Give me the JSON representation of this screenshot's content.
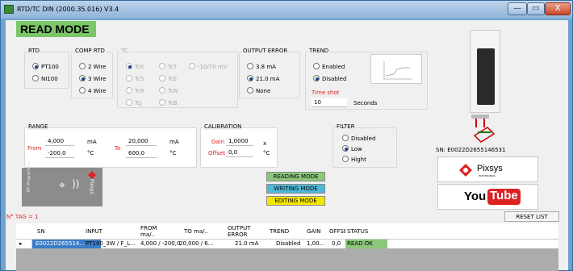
{
  "window": {
    "title": "RTD/TC DIN  (2000.35.016)  V3.4",
    "min": "—",
    "max": "▭",
    "close": "X"
  },
  "mode_title": "READ MODE",
  "rtd": {
    "label": "RTD",
    "opt1": "PT100",
    "opt2": "NI100"
  },
  "comp": {
    "label": "COMP RTD",
    "opt1": "2 Wire",
    "opt2": "3 Wire",
    "opt3": "4 Wire"
  },
  "tc": {
    "label": "TC",
    "k": "TcK",
    "s": "TcS",
    "r": "TcR",
    "j": "TcJ",
    "t": "TcT",
    "e": "TcE",
    "n": "TcN",
    "b": "TcB",
    "mv": "-10/70 mV"
  },
  "output_error": {
    "label": "OUTPUT ERROR",
    "opt1": "3.8 mA",
    "opt2": "21.0 mA",
    "opt3": "None"
  },
  "trend": {
    "label": "TREND",
    "opt1": "Enabled",
    "opt2": "Disabled",
    "time_shot_label": "Time shot",
    "time_shot": "10",
    "seconds": "Seconds"
  },
  "range": {
    "label": "RANGE",
    "from_label": "From",
    "to_label": "To",
    "from_ma": "4,000",
    "from_c": "-200,0",
    "to_ma": "20,000",
    "to_c": "600,0",
    "unit_ma": "mA",
    "unit_c": "°C"
  },
  "calibration": {
    "label": "CALIBRATION",
    "gain_label": "Gain",
    "gain": "1,0000",
    "gain_unit": "x",
    "offset_label": "Offset",
    "offset": "0,0",
    "offset_unit": "°C"
  },
  "filter": {
    "label": "FILTER",
    "opt1": "Disabled",
    "opt2": "Low",
    "opt3": "Hight"
  },
  "sn": "SN: E0022D2655146531",
  "pixsys": "Pixsys",
  "pixsys_sub": "ELECTRONICS",
  "youtube": {
    "you": "You",
    "tube": "Tube"
  },
  "ble": {
    "label": "BT Programmer",
    "brand": "Pixsys"
  },
  "modes": {
    "reading": "READING MODE",
    "writing": "WRITING MODE",
    "editing": "EDITING MODE"
  },
  "tag": "N° TAG = 1",
  "reset": "RESET LIST",
  "table": {
    "headers": [
      "SN",
      "INPUT",
      "FROM ma/..",
      "TO ma/..",
      "OUTPUT ERROR",
      "TREND",
      "GAIN",
      "OFFSET",
      "STATUS"
    ],
    "row": [
      "E0022D265514...",
      "PT100_3W / F_L...",
      "4,000 / -200,0",
      "20,000 / 6...",
      "21.0 mA",
      "Disabled",
      "1,00...",
      "0,0",
      "READ OK"
    ],
    "row_marker": "▸"
  },
  "colors": {
    "mode_green": "#7cc66a",
    "reading": "#8bc77a",
    "writing": "#4fb8d8",
    "editing": "#f5e600",
    "select": "#3b7dc9"
  }
}
